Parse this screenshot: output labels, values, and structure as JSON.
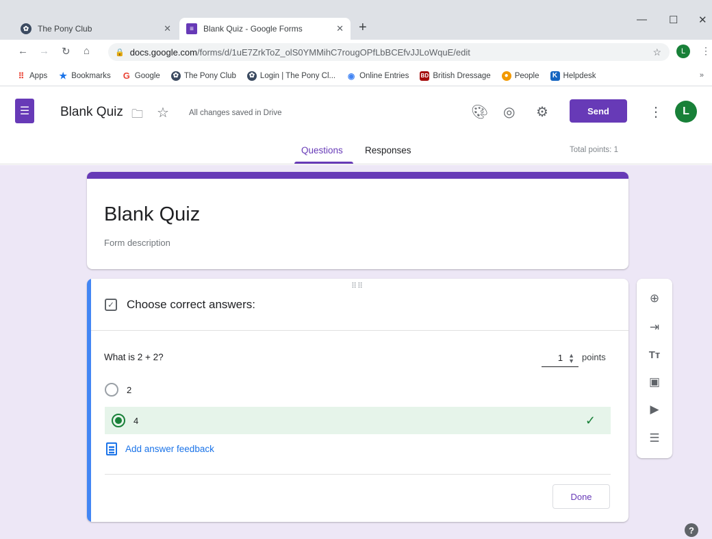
{
  "browser": {
    "tabs": [
      {
        "title": "The Pony Club",
        "icon": "pony-club-favicon"
      },
      {
        "title": "Blank Quiz - Google Forms",
        "icon": "google-forms-favicon"
      }
    ],
    "new_tab": "+",
    "address": {
      "host": "docs.google.com",
      "path": "/forms/d/1uE7ZrkToZ_olS0YMMihC7rougOPfLbBCEfvJJLoWquE/edit"
    },
    "profile_initial": "L",
    "bookmarks": [
      {
        "label": "Apps",
        "icon": "apps-grid-icon",
        "color": "#ea4335"
      },
      {
        "label": "Bookmarks",
        "icon": "star-icon",
        "color": "#1a73e8"
      },
      {
        "label": "Google",
        "icon": "google-g-icon",
        "color": "#ea4335"
      },
      {
        "label": "The Pony Club",
        "icon": "pony-club-favicon",
        "color": "#3b4a60"
      },
      {
        "label": "Login | The Pony Cl...",
        "icon": "pony-club-favicon",
        "color": "#3b4a60"
      },
      {
        "label": "Online Entries",
        "icon": "globe-icon",
        "color": "#4285f4"
      },
      {
        "label": "British Dressage",
        "icon": "bd-favicon",
        "color": "#a50e0e"
      },
      {
        "label": "People",
        "icon": "people-icon",
        "color": "#f29900"
      },
      {
        "label": "Helpdesk",
        "icon": "helpdesk-k-icon",
        "color": "#1565c0"
      }
    ],
    "bookmarks_more": "»"
  },
  "forms_header": {
    "form_name": "Blank Quiz",
    "save_status": "All changes saved in Drive",
    "send_label": "Send",
    "avatar_initial": "L",
    "tabs": {
      "questions": "Questions",
      "responses": "Responses"
    },
    "total_points": "Total points: 1"
  },
  "title_card": {
    "title": "Blank Quiz",
    "description": "Form description"
  },
  "question_card": {
    "answer_key_heading": "Choose correct answers:",
    "question": "What is 2 + 2?",
    "points_value": "1",
    "points_label": "points",
    "options": [
      {
        "label": "2",
        "correct": false
      },
      {
        "label": "4",
        "correct": true
      }
    ],
    "feedback_link": "Add answer feedback",
    "done_label": "Done"
  },
  "side_toolbar": [
    "add-question-icon",
    "import-questions-icon",
    "add-title-icon",
    "add-image-icon",
    "add-video-icon",
    "add-section-icon"
  ],
  "colors": {
    "accent": "#673ab7",
    "background": "#ede7f6",
    "correct": "#188038",
    "correct_bg": "#e6f4ea",
    "link": "#1a73e8",
    "active_card_bar": "#4285f4"
  }
}
